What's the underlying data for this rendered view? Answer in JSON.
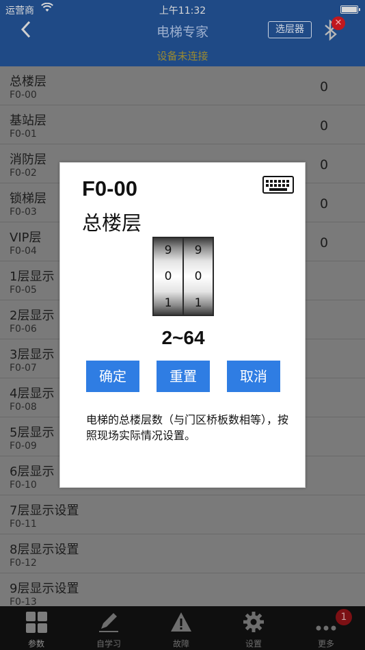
{
  "status_bar": {
    "carrier": "运营商",
    "wifi_icon": "wifi-icon",
    "time": "上午11:32",
    "battery_icon": "battery-icon"
  },
  "header": {
    "back_icon": "chevron-left-icon",
    "title": "电梯专家",
    "select_button": "选层器",
    "bluetooth_icon": "bluetooth-icon",
    "disconnected_icon": "close-icon",
    "connection_status": "设备未连接"
  },
  "list": [
    {
      "name": "总楼层",
      "code": "F0-00",
      "value": "0"
    },
    {
      "name": "基站层",
      "code": "F0-01",
      "value": "0"
    },
    {
      "name": "消防层",
      "code": "F0-02",
      "value": "0"
    },
    {
      "name": "锁梯层",
      "code": "F0-03",
      "value": "0"
    },
    {
      "name": "VIP层",
      "code": "F0-04",
      "value": "0"
    },
    {
      "name": "1层显示",
      "code": "F0-05",
      "value": ""
    },
    {
      "name": "2层显示",
      "code": "F0-06",
      "value": ""
    },
    {
      "name": "3层显示",
      "code": "F0-07",
      "value": ""
    },
    {
      "name": "4层显示",
      "code": "F0-08",
      "value": ""
    },
    {
      "name": "5层显示",
      "code": "F0-09",
      "value": ""
    },
    {
      "name": "6层显示",
      "code": "F0-10",
      "value": ""
    },
    {
      "name": "7层显示设置",
      "code": "F0-11",
      "value": ""
    },
    {
      "name": "8层显示设置",
      "code": "F0-12",
      "value": ""
    },
    {
      "name": "9层显示设置",
      "code": "F0-13",
      "value": ""
    }
  ],
  "dialog": {
    "code": "F0-00",
    "name": "总楼层",
    "keyboard_icon": "keyboard-icon",
    "wheels": [
      {
        "above": "9",
        "current": "0",
        "below": "1"
      },
      {
        "above": "9",
        "current": "0",
        "below": "1"
      }
    ],
    "range": "2~64",
    "confirm": "确定",
    "reset": "重置",
    "cancel": "取消",
    "description": "电梯的总楼层数（与门区桥板数相等），按照现场实际情况设置。"
  },
  "tabs": [
    {
      "label": "参数",
      "icon": "grid-icon",
      "active": true
    },
    {
      "label": "自学习",
      "icon": "pencil-icon",
      "active": false
    },
    {
      "label": "故障",
      "icon": "warning-icon",
      "active": false
    },
    {
      "label": "设置",
      "icon": "gear-icon",
      "active": false
    },
    {
      "label": "更多",
      "icon": "more-icon",
      "active": false,
      "badge": "1"
    }
  ]
}
